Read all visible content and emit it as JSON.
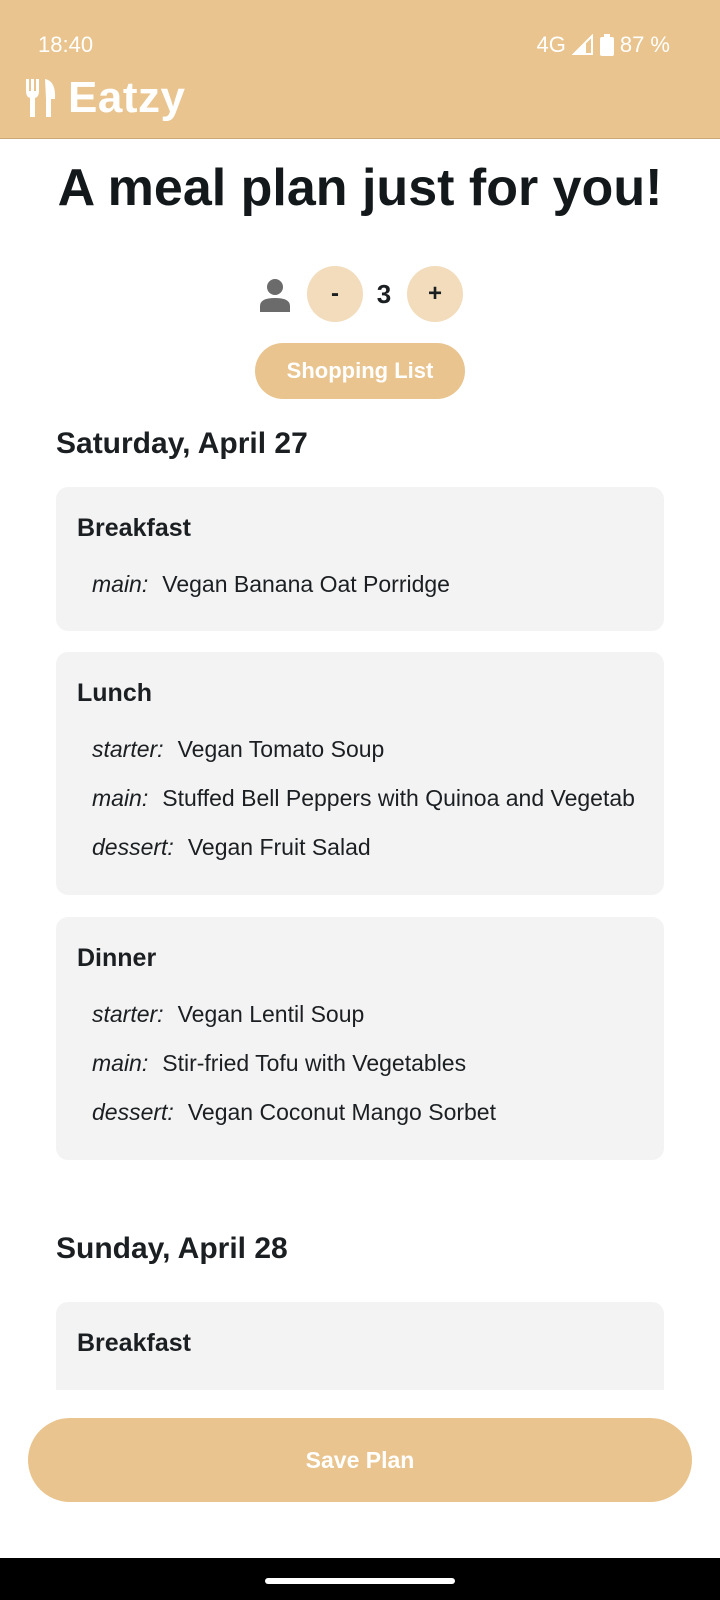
{
  "status": {
    "time": "18:40",
    "network": "4G",
    "battery": "87 %"
  },
  "app": {
    "name": "Eatzy",
    "icon": "fork-knife-icon",
    "header_color": "#e9c48e"
  },
  "main": {
    "title": "A meal plan just for you!",
    "people": {
      "icon": "person-icon",
      "decrement_label": "-",
      "count": "3",
      "increment_label": "+"
    },
    "shopping_list_label": "Shopping List",
    "days": [
      {
        "heading": "Saturday, April 27",
        "meals": [
          {
            "title": "Breakfast",
            "dishes": [
              {
                "course": "main:",
                "name": "Vegan Banana Oat Porridge"
              }
            ]
          },
          {
            "title": "Lunch",
            "dishes": [
              {
                "course": "starter:",
                "name": "Vegan Tomato Soup"
              },
              {
                "course": "main:",
                "name": "Stuffed Bell Peppers with Quinoa and Vegetab"
              },
              {
                "course": "dessert:",
                "name": "Vegan Fruit Salad"
              }
            ]
          },
          {
            "title": "Dinner",
            "dishes": [
              {
                "course": "starter:",
                "name": "Vegan Lentil Soup"
              },
              {
                "course": "main:",
                "name": "Stir-fried Tofu with Vegetables"
              },
              {
                "course": "dessert:",
                "name": "Vegan Coconut Mango Sorbet"
              }
            ]
          }
        ]
      },
      {
        "heading": "Sunday, April 28",
        "meals": [
          {
            "title": "Breakfast",
            "dishes": []
          }
        ]
      }
    ]
  },
  "footer": {
    "save_label": "Save Plan"
  }
}
